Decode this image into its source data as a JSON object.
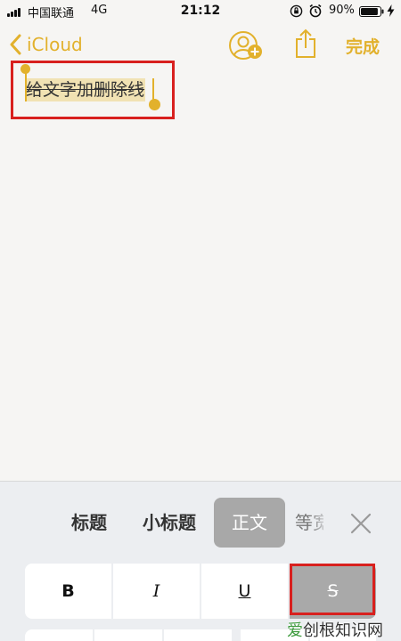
{
  "status": {
    "carrier": "中国联通",
    "network": "4G",
    "time": "21:12",
    "battery": "90%",
    "battery_level": 0.9
  },
  "nav": {
    "back_label": "iCloud",
    "done_label": "完成",
    "accent_color": "#e2b12c"
  },
  "note": {
    "text": "给文字加删除线"
  },
  "format_panel": {
    "styles": [
      "标题",
      "小标题",
      "正文",
      "等宽"
    ],
    "selected_style": "正文",
    "buttons": {
      "bold": "B",
      "italic": "I",
      "underline": "U",
      "strikethrough": "S"
    },
    "active_button": "strikethrough"
  },
  "watermark": {
    "brand_green": "爱",
    "brand_rest": "创根",
    "site": "知识网"
  },
  "colors": {
    "highlight_red": "#d8201e",
    "selection_bg": "#f1e2b3",
    "panel_bg": "#eceef1"
  }
}
